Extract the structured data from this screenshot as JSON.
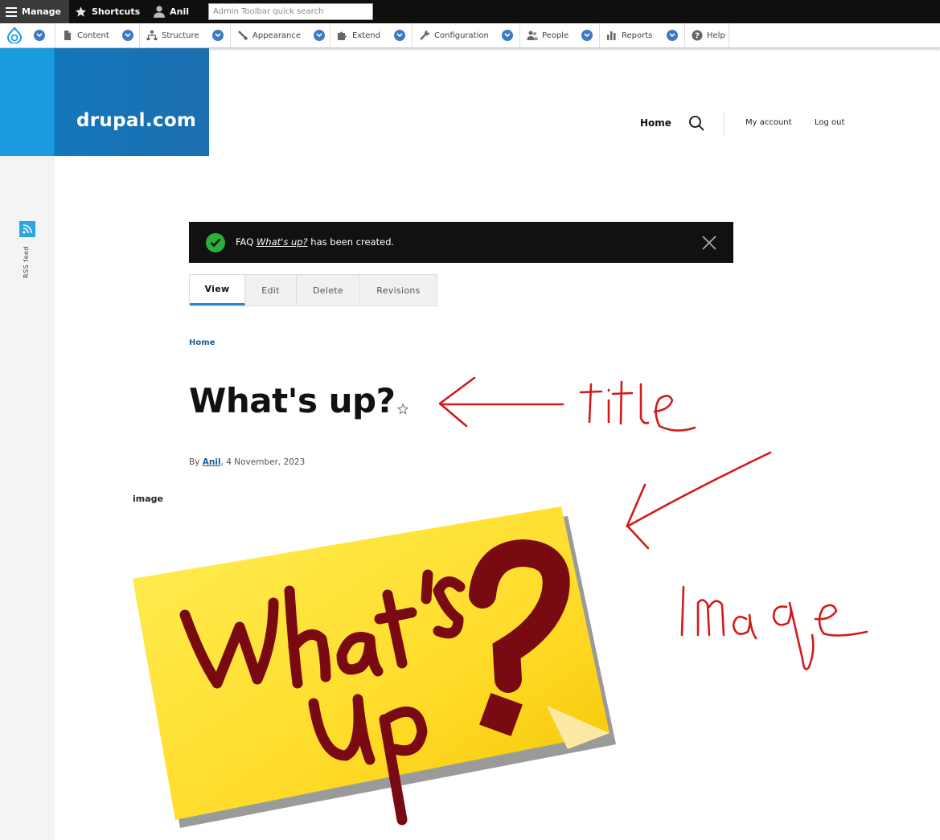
{
  "toolbar": {
    "manage": "Manage",
    "shortcuts": "Shortcuts",
    "user": "Anil",
    "search_placeholder": "Admin Toolbar quick search"
  },
  "tray": {
    "items": [
      {
        "label": "Content",
        "icon": "document-icon"
      },
      {
        "label": "Structure",
        "icon": "sitemap-icon"
      },
      {
        "label": "Appearance",
        "icon": "paintbrush-icon"
      },
      {
        "label": "Extend",
        "icon": "puzzle-icon"
      },
      {
        "label": "Configuration",
        "icon": "wrench-icon"
      },
      {
        "label": "People",
        "icon": "people-icon"
      },
      {
        "label": "Reports",
        "icon": "bar-chart-icon"
      },
      {
        "label": "Help",
        "icon": "help-icon"
      }
    ]
  },
  "sidebar": {
    "rss_label": "RSS feed"
  },
  "site": {
    "name": "drupal.com"
  },
  "header_nav": {
    "home": "Home",
    "my_account": "My account",
    "log_out": "Log out"
  },
  "status": {
    "prefix": "FAQ ",
    "link": "What's up?",
    "suffix": " has been created."
  },
  "tabs": [
    "View",
    "Edit",
    "Delete",
    "Revisions"
  ],
  "breadcrumb": {
    "home": "Home"
  },
  "node": {
    "title": "What's up?",
    "by": "By ",
    "author": "Anil",
    "date": ", 4 November, 2023",
    "field_label": "image"
  },
  "annotations": {
    "title": "title",
    "image": "Image"
  },
  "colors": {
    "accent": "#1f8ad0",
    "brand_light": "#1a9be0",
    "brand_dark": "#1477bb",
    "success": "#2bb03b",
    "annotation": "#d11a1a"
  }
}
